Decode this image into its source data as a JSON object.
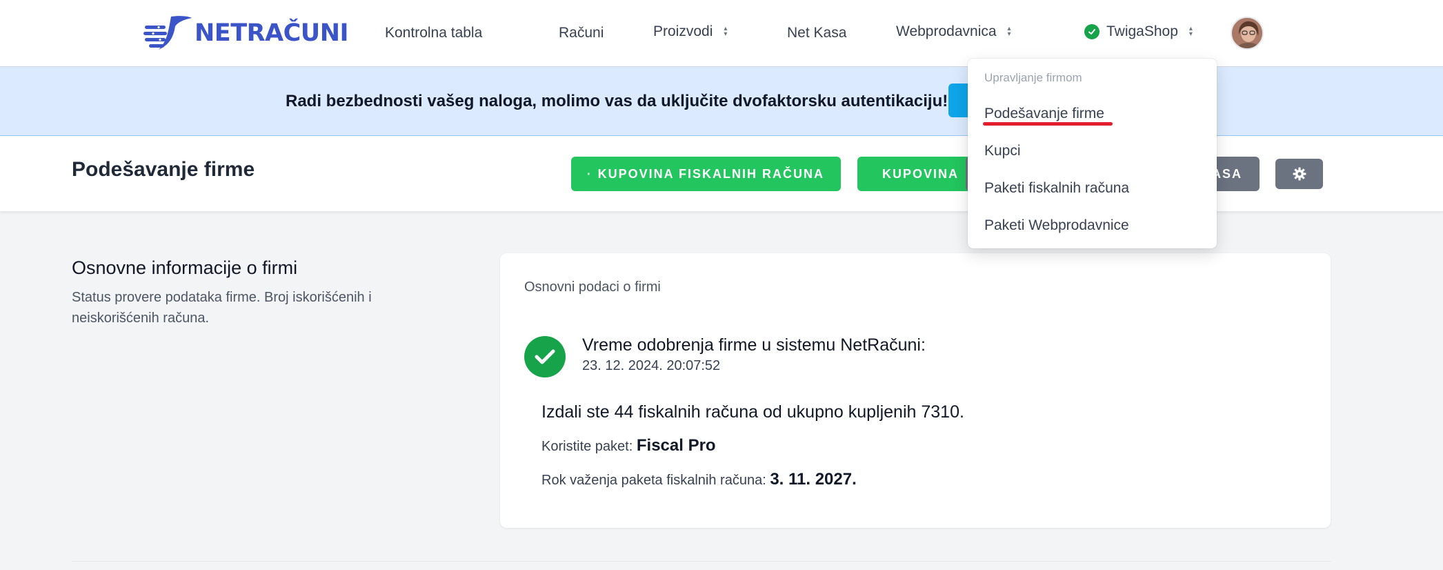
{
  "brand": {
    "name": "NETRAČUNI",
    "accent_color": "#3b55c8"
  },
  "nav": {
    "items": [
      {
        "label": "Kontrolna tabla"
      },
      {
        "label": "Računi"
      },
      {
        "label": "Proizvodi"
      },
      {
        "label": "Net Kasa"
      },
      {
        "label": "Webprodavnica"
      }
    ],
    "shop": {
      "label": "TwigaShop",
      "status_icon": "check-circle-icon",
      "status_color": "#16a34a"
    },
    "avatar_icon": "user-avatar"
  },
  "banner": {
    "message": "Radi bezbednosti vašeg naloga, molimo vas da uključite dvofaktorsku autentikaciju!",
    "bg_color": "#dbeafe"
  },
  "header": {
    "title": "Podešavanje firme",
    "buttons": [
      {
        "label": "KUPOVINA FISKALNIH RAČUNA",
        "icon": "receipt-icon",
        "color": "#22c55e"
      },
      {
        "label": "KUPOVINA",
        "icon": "store-icon",
        "color": "#22c55e"
      },
      {
        "label": "ASA",
        "color": "#6b7280"
      }
    ],
    "settings_icon": "gear-icon"
  },
  "section": {
    "title": "Osnovne informacije o firmi",
    "description": "Status provere podataka firme. Broj iskorišćenih i neiskorišćenih računa."
  },
  "card": {
    "heading": "Osnovni podaci o firmi",
    "approval_label": "Vreme odobrenja firme u sistemu NetRačuni:",
    "approval_time": "23. 12. 2024. 20:07:52",
    "issued_text": "Izdali ste 44 fiskalnih računa od ukupno kupljenih 7310.",
    "package_label": "Koristite paket:",
    "package_value": "Fiscal Pro",
    "expiry_label": "Rok važenja paketa fiskalnih računa:",
    "expiry_value": "3. 11. 2027."
  },
  "dropdown": {
    "header": "Upravljanje firmom",
    "items": [
      {
        "label": "Podešavanje firme"
      },
      {
        "label": "Kupci"
      },
      {
        "label": "Paketi fiskalnih računa"
      },
      {
        "label": "Paketi Webprodavnice"
      }
    ],
    "highlight_color": "#e11d2e"
  }
}
